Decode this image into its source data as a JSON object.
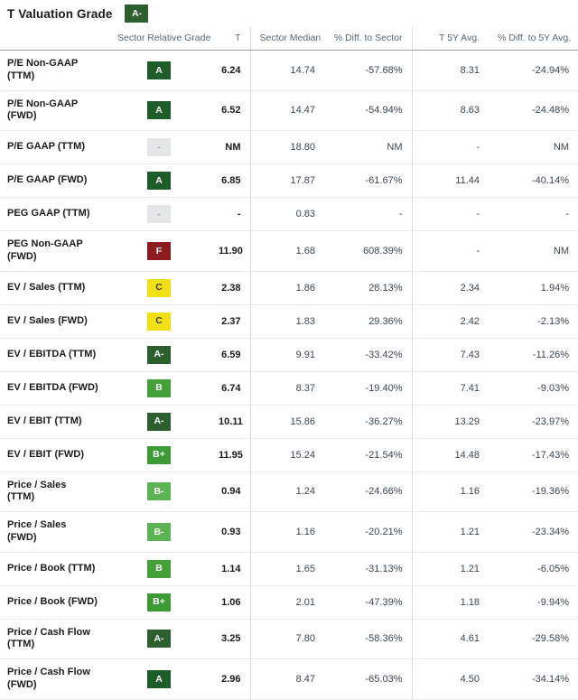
{
  "header": {
    "title": "T Valuation Grade",
    "overall_grade": "A-"
  },
  "table": {
    "columns": [
      "",
      "Sector Relative Grade",
      "T",
      "Sector Median",
      "% Diff. to Sector",
      "T 5Y Avg.",
      "% Diff. to 5Y Avg."
    ],
    "rows": [
      {
        "metric": "P/E Non-GAAP (TTM)",
        "grade": "A",
        "t": "6.24",
        "sector_median": "14.74",
        "diff_sector": "-57.68%",
        "t_5y_avg": "8.31",
        "diff_5y_avg": "-24.94%"
      },
      {
        "metric": "P/E Non-GAAP (FWD)",
        "grade": "A",
        "t": "6.52",
        "sector_median": "14.47",
        "diff_sector": "-54.94%",
        "t_5y_avg": "8.63",
        "diff_5y_avg": "-24.48%"
      },
      {
        "metric": "P/E GAAP (TTM)",
        "grade": "-",
        "t": "NM",
        "sector_median": "18.80",
        "diff_sector": "NM",
        "t_5y_avg": "-",
        "diff_5y_avg": "NM"
      },
      {
        "metric": "P/E GAAP (FWD)",
        "grade": "A",
        "t": "6.85",
        "sector_median": "17.87",
        "diff_sector": "-61.67%",
        "t_5y_avg": "11.44",
        "diff_5y_avg": "-40.14%"
      },
      {
        "metric": "PEG GAAP (TTM)",
        "grade": "-",
        "t": "-",
        "sector_median": "0.83",
        "diff_sector": "-",
        "t_5y_avg": "-",
        "diff_5y_avg": "-"
      },
      {
        "metric": "PEG Non-GAAP (FWD)",
        "grade": "F",
        "t": "11.90",
        "sector_median": "1.68",
        "diff_sector": "608.39%",
        "t_5y_avg": "-",
        "diff_5y_avg": "NM"
      },
      {
        "metric": "EV / Sales (TTM)",
        "grade": "C",
        "t": "2.38",
        "sector_median": "1.86",
        "diff_sector": "28.13%",
        "t_5y_avg": "2.34",
        "diff_5y_avg": "1.94%"
      },
      {
        "metric": "EV / Sales (FWD)",
        "grade": "C",
        "t": "2.37",
        "sector_median": "1.83",
        "diff_sector": "29.36%",
        "t_5y_avg": "2.42",
        "diff_5y_avg": "-2.13%"
      },
      {
        "metric": "EV / EBITDA (TTM)",
        "grade": "A-",
        "t": "6.59",
        "sector_median": "9.91",
        "diff_sector": "-33.42%",
        "t_5y_avg": "7.43",
        "diff_5y_avg": "-11.26%"
      },
      {
        "metric": "EV / EBITDA (FWD)",
        "grade": "B",
        "t": "6.74",
        "sector_median": "8.37",
        "diff_sector": "-19.40%",
        "t_5y_avg": "7.41",
        "diff_5y_avg": "-9.03%"
      },
      {
        "metric": "EV / EBIT (TTM)",
        "grade": "A-",
        "t": "10.11",
        "sector_median": "15.86",
        "diff_sector": "-36.27%",
        "t_5y_avg": "13.29",
        "diff_5y_avg": "-23.97%"
      },
      {
        "metric": "EV / EBIT (FWD)",
        "grade": "B+",
        "t": "11.95",
        "sector_median": "15.24",
        "diff_sector": "-21.54%",
        "t_5y_avg": "14.48",
        "diff_5y_avg": "-17.43%"
      },
      {
        "metric": "Price / Sales (TTM)",
        "grade": "B-",
        "t": "0.94",
        "sector_median": "1.24",
        "diff_sector": "-24.66%",
        "t_5y_avg": "1.16",
        "diff_5y_avg": "-19.36%"
      },
      {
        "metric": "Price / Sales (FWD)",
        "grade": "B-",
        "t": "0.93",
        "sector_median": "1.16",
        "diff_sector": "-20.21%",
        "t_5y_avg": "1.21",
        "diff_5y_avg": "-23.34%"
      },
      {
        "metric": "Price / Book (TTM)",
        "grade": "B",
        "t": "1.14",
        "sector_median": "1.65",
        "diff_sector": "-31.13%",
        "t_5y_avg": "1.21",
        "diff_5y_avg": "-6.05%"
      },
      {
        "metric": "Price / Book (FWD)",
        "grade": "B+",
        "t": "1.06",
        "sector_median": "2.01",
        "diff_sector": "-47.39%",
        "t_5y_avg": "1.18",
        "diff_5y_avg": "-9.94%"
      },
      {
        "metric": "Price / Cash Flow (TTM)",
        "grade": "A-",
        "t": "3.25",
        "sector_median": "7.80",
        "diff_sector": "-58.36%",
        "t_5y_avg": "4.61",
        "diff_5y_avg": "-29.58%"
      },
      {
        "metric": "Price / Cash Flow (FWD)",
        "grade": "A",
        "t": "2.96",
        "sector_median": "8.47",
        "diff_sector": "-65.03%",
        "t_5y_avg": "4.50",
        "diff_5y_avg": "-34.14%"
      }
    ]
  },
  "grade_colors": {
    "A": "#1e5c29",
    "A-": "#2c5e2e",
    "B+": "#3d9b35",
    "B": "#44a038",
    "B-": "#5cb354",
    "C": "#f2e017",
    "F": "#8c1c20",
    "-": "#e4e6e8"
  },
  "grade_text_colors": {
    "C": "#3a3a1a",
    "-": "#9aa0a6"
  }
}
